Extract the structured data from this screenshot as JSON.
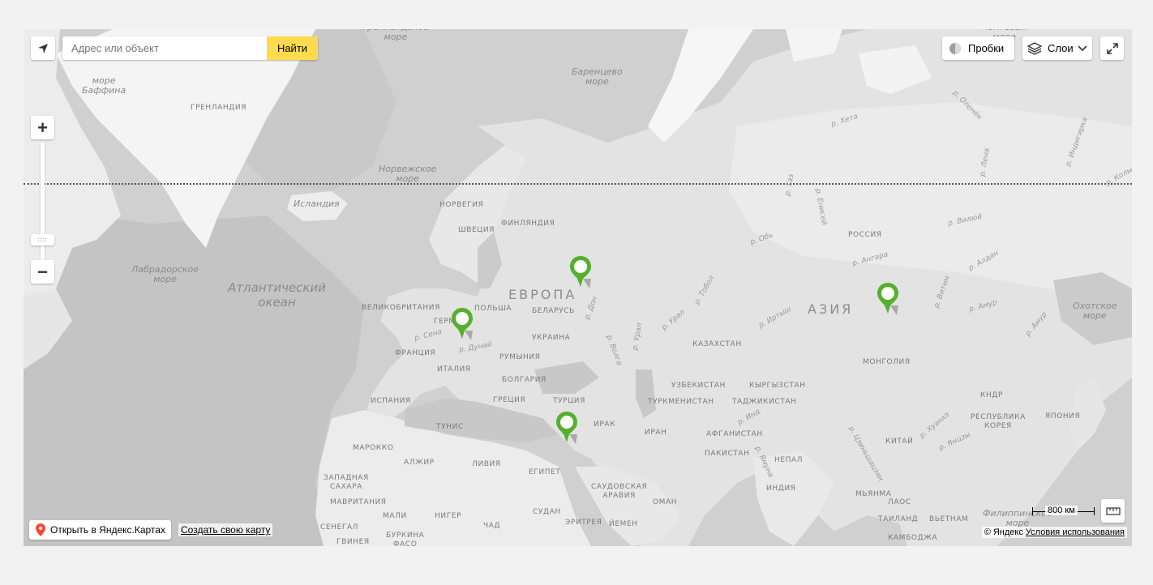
{
  "search": {
    "placeholder": "Адрес или объект",
    "button_label": "Найти"
  },
  "controls": {
    "traffic_label": "Пробки",
    "layers_label": "Слои",
    "zoom_in": "+",
    "zoom_out": "−"
  },
  "bottom": {
    "open_label": "Открыть в Яндекс.Картах",
    "create_label": "Создать свою карту",
    "copyright": "© Яндекс",
    "terms_label": "Условия использования",
    "scale_label": "800 км"
  },
  "map_labels": {
    "greenland_sea": "Гренландское\nморе",
    "barents_sea": "Баренцево\nморе",
    "laptev_sea": "Лаптевых\nморе",
    "baffin_sea": "море\nБаффина",
    "greenland": "ГРЕНЛАНДИЯ",
    "norwegian_sea": "Норвежское\nморе",
    "iceland": "Исландия",
    "norway": "НОРВЕГИЯ",
    "finland": "ФИНЛЯНДИЯ",
    "sweden": "ШВЕЦИЯ",
    "labrador_sea": "Лабрадорское\nморе",
    "atlantic_ocean": "Атлантический\nокеан",
    "europe": "ЕВРОПА",
    "asia": "АЗИЯ",
    "russia": "РОССИЯ",
    "uk": "ВЕЛИКОБРИТАНИЯ",
    "poland": "ПОЛЬША",
    "belarus": "БЕЛАРУСЬ",
    "germany": "ГЕРМ",
    "ukraine": "УКРАИНА",
    "france": "ФРАНЦИЯ",
    "romania": "РУМЫНИЯ",
    "italy": "ИТАЛИЯ",
    "bulgaria": "БОЛГАРИЯ",
    "spain": "ИСПАНИЯ",
    "greece": "ГРЕЦИЯ",
    "turkey": "ТУРЦИЯ",
    "tunisia": "ТУНИС",
    "morocco": "МАРОККО",
    "algeria": "АЛЖИР",
    "libya": "ЛИВИЯ",
    "egypt": "ЕГИПЕТ",
    "western_sahara": "ЗАПАДНАЯ\nСАХАРА",
    "mauritania": "МАВРИТАНИЯ",
    "mali": "МАЛИ",
    "niger": "НИГЕР",
    "chad": "ЧАД",
    "sudan": "СУДАН",
    "senegal": "СЕНЕГАЛ",
    "guinea": "ГВИНЕЯ",
    "burkina": "БУРКИНА\nФАСО",
    "eritrea": "ЭРИТРЕЯ",
    "yemen": "ЙЕМЕН",
    "saudi": "САУДОВСКАЯ\nАРАВИЯ",
    "oman": "ОМАН",
    "iraq": "ИРАК",
    "iran": "ИРАН",
    "afghanistan": "АФГАНИСТАН",
    "pakistan": "ПАКИСТАН",
    "india": "ИНДИЯ",
    "nepal": "НЕПАЛ",
    "kazakhstan": "КАЗАХСТАН",
    "uzbekistan": "УЗБЕКИСТАН",
    "turkmenistan": "ТУРКМЕНИСТАН",
    "kyrgyzstan": "КЫРГЫЗСТАН",
    "tajikistan": "ТАДЖИКИСТАН",
    "mongolia": "МОНГОЛИЯ",
    "china": "КИТАЙ",
    "kndr": "КНДР",
    "korea": "РЕСПУБЛИКА\nКОРЕЯ",
    "japan": "ЯПОНИЯ",
    "myanmar": "МЬЯНМА",
    "thailand": "ТАИЛАНД",
    "vietnam": "ВЬЕТНАМ",
    "cambodia": "КАМБОДЖА",
    "laos": "ЛАОС",
    "philippine_sea": "Филиппинское\nморе",
    "okhotsk_sea": "Охотское\nморе",
    "r_seine": "р. Сена",
    "r_danube": "р. Дунай",
    "r_don": "р. Дон",
    "r_volga": "р. Волга",
    "r_ural": "р. Урал",
    "r_ural2": "р. Урал",
    "r_tobol": "р. Тобол",
    "r_irtysh": "р. Иртыш",
    "r_ob": "р. Обь",
    "r_angara": "р. Ангара",
    "r_vilyuy": "р. Вилюй",
    "r_aldan": "р. Алдан",
    "r_amur": "р. Амур",
    "r_amur2": "р. Амур",
    "r_vitim": "р. Витим",
    "r_lena": "р. Лена",
    "r_olenek": "р. Оленёк",
    "r_kheta": "р. Хета",
    "r_yenisei": "р. Енисей",
    "r_taz": "р. Таз",
    "r_indigirka": "р. Индигирка",
    "r_kolyma": "р. Колыма",
    "r_ind": "р. Инд",
    "r_yamuna": "р. Ямуна",
    "r_huanghe": "р. Хуанхэ",
    "r_yangtze": "р. Янцзы",
    "r_zhu": "р. Цзиньшацзян"
  }
}
